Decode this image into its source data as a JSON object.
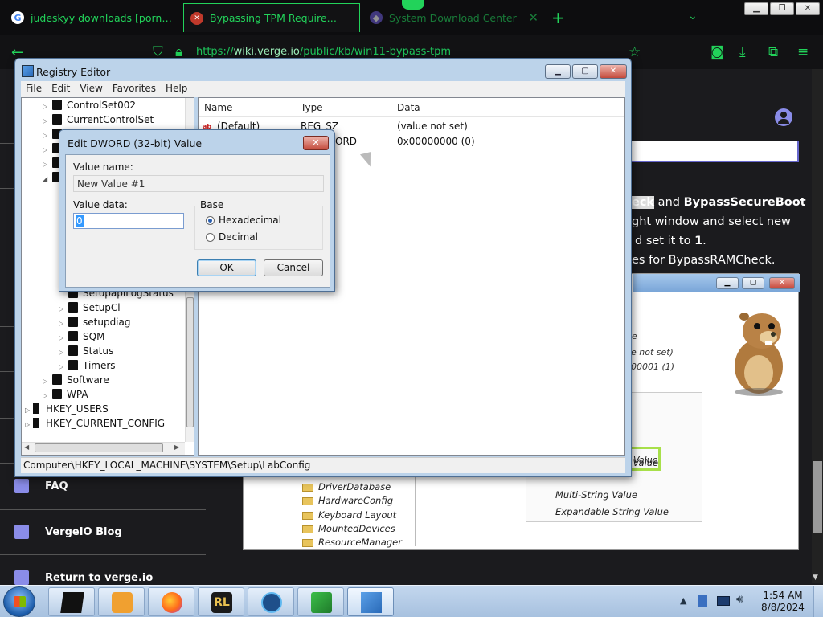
{
  "browser": {
    "tabs": [
      {
        "label": "judeskyy downloads [porn - Go",
        "icon": "google-icon"
      },
      {
        "label": "Bypassing TPM Requirements",
        "icon": "verge-icon"
      },
      {
        "label": "System Download Center",
        "icon": "microsoft-icon"
      }
    ],
    "url_prefix": "https://",
    "url_host": "wiki.verge.io",
    "url_path": "/public/kb/win11-bypass-tpm",
    "accent_color": "#22d35a"
  },
  "article": {
    "line1_pre": "eck",
    "line1_mid": " and ",
    "line1_bold": "BypassSecureBoot",
    "line2": "ght window and select new",
    "line3_pre": "d set it to ",
    "line3_bold": "1",
    "line3_post": ".",
    "line4": "es for BypassRAMCheck.",
    "shot": {
      "default_partial": "ue not set)",
      "dword_partial": "000001 (1)",
      "menu_highlight": "Value",
      "menu_items": [
        "QWORD (64-bit) Value",
        "Multi-String Value",
        "Expandable String Value"
      ],
      "tree_items": [
        "DriverDatabase",
        "HardwareConfig",
        "Keyboard Layout",
        "MountedDevices",
        "ResourceManager"
      ]
    }
  },
  "side_nav": [
    {
      "label": "FAQ",
      "icon": "faq-icon"
    },
    {
      "label": "VergeIO Blog",
      "icon": "blog-icon"
    },
    {
      "label": "Return to verge.io",
      "icon": "return-icon"
    }
  ],
  "regedit": {
    "title": "Registry Editor",
    "menu": [
      "File",
      "Edit",
      "View",
      "Favorites",
      "Help"
    ],
    "tree_top": [
      "ControlSet002",
      "CurrentControlSet"
    ],
    "tree_mid": [
      "SetupapiLogStatus",
      "SetupCl",
      "setupdiag",
      "SQM",
      "Status",
      "Timers"
    ],
    "tree_root_children": [
      "Software",
      "WPA"
    ],
    "tree_hives": [
      "HKEY_USERS",
      "HKEY_CURRENT_CONFIG"
    ],
    "columns": {
      "name": "Name",
      "type": "Type",
      "data": "Data"
    },
    "values": [
      {
        "name": "(Default)",
        "type": "REG_SZ",
        "data": "(value not set)"
      },
      {
        "name": "",
        "type": "ORD",
        "data": "0x00000000 (0)"
      }
    ],
    "status_path": "Computer\\HKEY_LOCAL_MACHINE\\SYSTEM\\Setup\\LabConfig"
  },
  "dialog": {
    "title": "Edit DWORD (32-bit) Value",
    "value_name_label": "Value name:",
    "value_name": "New Value #1",
    "value_data_label": "Value data:",
    "value_data": "0",
    "base_label": "Base",
    "base_options": [
      "Hexadecimal",
      "Decimal"
    ],
    "base_selected": "Hexadecimal",
    "ok_label": "OK",
    "cancel_label": "Cancel"
  },
  "taskbar": {
    "time": "1:54 AM",
    "date": "8/8/2024",
    "apps": [
      "explorer-icon",
      "media-player-icon",
      "firefox-icon",
      "rl-app-icon",
      "flame-app-icon",
      "green-arrow-app-icon",
      "regedit-icon"
    ]
  }
}
